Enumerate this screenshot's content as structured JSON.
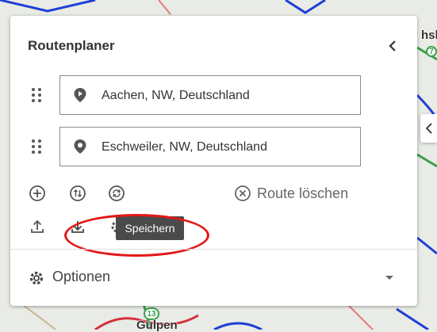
{
  "panel": {
    "title": "Routenplaner",
    "waypoints": [
      {
        "label": "Aachen, NW, Deutschland",
        "icon": "start-pin-icon"
      },
      {
        "label": "Eschweiler, NW, Deutschland",
        "icon": "destination-pin-icon"
      }
    ],
    "actions": {
      "clear_route_label": "Route löschen"
    },
    "tooltip": "Speichern",
    "options_label": "Optionen"
  },
  "map": {
    "labels": {
      "top_right": "hsl",
      "bottom": "Gulpen",
      "route_badge_7": "7",
      "route_badge_13": "13"
    }
  },
  "colors": {
    "route_blue": "#1f3fd6",
    "route_red": "#d62f3a",
    "road_green": "#3aa04a",
    "highlight": "#e31818"
  }
}
